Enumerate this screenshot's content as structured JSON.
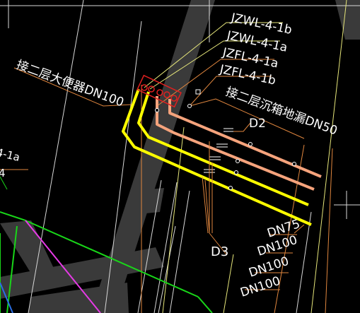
{
  "colors": {
    "background": "#000000",
    "band": "#3a3a3a",
    "white_line": "#d8d8d8",
    "light_yellow": "#e6e67a",
    "orange": "#e0863e",
    "yellow_pipe": "#ffff00",
    "salmon_pipe": "#f5a37c",
    "green": "#19d619",
    "magenta": "#e63ae6",
    "blue": "#2a6fe6",
    "red_marker": "#e02020",
    "label_text": "#ffffff"
  },
  "labels": {
    "pipe_tags": [
      "JZWL-4-1b",
      "JZWL-4-1a",
      "JZFL-4-1a",
      "JZFL-4-1b"
    ],
    "note_left": "接二层大便器DN100",
    "note_right": "接二层沉箱地漏DN50",
    "size_d2": "D2",
    "size_d3": "D3",
    "dn_list": [
      "DN75",
      "DN100",
      "DN100",
      "DN100"
    ],
    "edge_left_top": "4-1a",
    "edge_left_bottom": "4"
  }
}
